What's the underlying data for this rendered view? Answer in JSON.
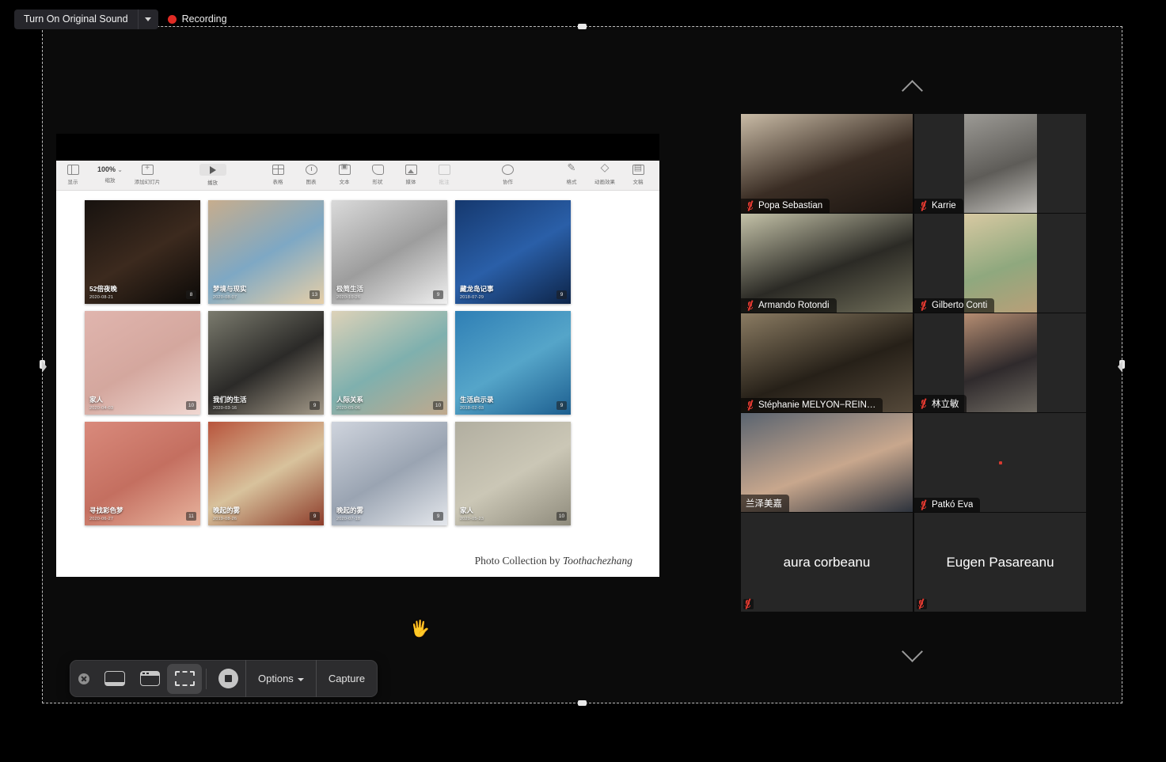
{
  "zoom_toolbar": {
    "original_sound_label": "Turn On Original Sound",
    "dropdown_icon": "chevron-down-icon",
    "recording_label": "Recording",
    "recording_dot_color": "#e02b24"
  },
  "shared_screen": {
    "app": "keynote",
    "toolbar": {
      "zoom_value": "100%",
      "items": [
        {
          "icon": "sidebar-view-icon",
          "label": "显示"
        },
        {
          "icon": "zoom-level-icon",
          "label": "缩放"
        },
        {
          "icon": "add-slide-icon",
          "label": "添加幻灯片"
        },
        {
          "icon": "play-icon",
          "label": "播放"
        },
        {
          "icon": "table-icon",
          "label": "表格"
        },
        {
          "icon": "chart-icon",
          "label": "图表"
        },
        {
          "icon": "text-icon",
          "label": "文本"
        },
        {
          "icon": "shape-icon",
          "label": "形状"
        },
        {
          "icon": "media-icon",
          "label": "媒体"
        },
        {
          "icon": "comment-icon",
          "label": "批注"
        },
        {
          "icon": "collaborate-icon",
          "label": "协作"
        },
        {
          "icon": "format-icon",
          "label": "格式"
        },
        {
          "icon": "animate-icon",
          "label": "动画效果"
        },
        {
          "icon": "document-icon",
          "label": "文稿"
        }
      ]
    },
    "slide": {
      "credit_prefix": "Photo Collection by ",
      "credit_author": "Toothachezhang",
      "photos": [
        {
          "title": "52倍夜晚",
          "date": "2020-08-21",
          "count": "8",
          "palette": [
            "#17120f",
            "#3c2a1e",
            "#0b0907"
          ]
        },
        {
          "title": "梦境与现实",
          "date": "2020-08-07",
          "count": "13",
          "palette": [
            "#c7ad8d",
            "#7ea8c4",
            "#e6cfa8"
          ]
        },
        {
          "title": "极简生活",
          "date": "2020-10-26",
          "count": "9",
          "palette": [
            "#dadada",
            "#9d9d9d",
            "#efefef"
          ]
        },
        {
          "title": "藏龙岛记事",
          "date": "2018-07-29",
          "count": "9",
          "palette": [
            "#15386e",
            "#2a5fa8",
            "#0d2448"
          ]
        },
        {
          "title": "家人",
          "date": "2020-04-03",
          "count": "10",
          "palette": [
            "#e0b5ae",
            "#d4a79e",
            "#f0d8d2"
          ]
        },
        {
          "title": "我们的生活",
          "date": "2020-03-16",
          "count": "9",
          "palette": [
            "#7b7b6e",
            "#2b2a28",
            "#a59b8a"
          ]
        },
        {
          "title": "人际关系",
          "date": "2020-05-06",
          "count": "10",
          "palette": [
            "#ddd2b8",
            "#7fb0ae",
            "#c0a98d"
          ]
        },
        {
          "title": "生活启示录",
          "date": "2018-02-03",
          "count": "9",
          "palette": [
            "#2f7fb5",
            "#55a5c9",
            "#1d5f90"
          ]
        },
        {
          "title": "寻找彩色梦",
          "date": "2020-06-27",
          "count": "11",
          "palette": [
            "#d98a7c",
            "#c46f60",
            "#e8b49e"
          ]
        },
        {
          "title": "晚起的雾",
          "date": "2019-08-26",
          "count": "9",
          "palette": [
            "#b8543c",
            "#d8c29c",
            "#8d3c2a"
          ]
        },
        {
          "title": "晚起的雾",
          "date": "2020-07-18",
          "count": "9",
          "palette": [
            "#cfd4dd",
            "#9aa4b2",
            "#e4e7ec"
          ]
        },
        {
          "title": "家人",
          "date": "2020-05-23",
          "count": "10",
          "palette": [
            "#b1aea0",
            "#cbc7b6",
            "#8f8b7c"
          ]
        }
      ]
    }
  },
  "participants": {
    "scroll_up_icon": "chevron-up-icon",
    "scroll_down_icon": "chevron-down-icon",
    "tiles": [
      {
        "name": "Popa Sebastian",
        "muted": true,
        "video": true,
        "fit": "cover",
        "palette": [
          "#c9bba6",
          "#3a2d24",
          "#1a1410"
        ]
      },
      {
        "name": "Karrie",
        "muted": true,
        "video": true,
        "fit": "contain",
        "palette": [
          "#9c9a95",
          "#5e5c58",
          "#c2c0bb"
        ]
      },
      {
        "name": "Armando Rotondi",
        "muted": true,
        "video": true,
        "fit": "cover",
        "palette": [
          "#c4c2a8",
          "#2b2a25",
          "#6e6c58"
        ]
      },
      {
        "name": "Gilberto Conti",
        "muted": true,
        "video": true,
        "fit": "contain",
        "palette": [
          "#d8c9a2",
          "#8fa87e",
          "#b99f78"
        ]
      },
      {
        "name": "Stéphanie MELYON−REIN…",
        "muted": true,
        "video": true,
        "fit": "cover",
        "palette": [
          "#8a7b62",
          "#262018",
          "#55493a"
        ]
      },
      {
        "name": "林立敏",
        "muted": true,
        "video": true,
        "fit": "contain",
        "palette": [
          "#b58d72",
          "#2f2a2c",
          "#6f6a62"
        ]
      },
      {
        "name": "兰泽美嘉",
        "muted": false,
        "video": true,
        "fit": "cover",
        "palette": [
          "#5a6470",
          "#c8a78d",
          "#2c323c"
        ],
        "active": true
      },
      {
        "name": "Patkó Éva",
        "muted": true,
        "video": false,
        "fit": "none",
        "palette": [
          "#262626"
        ],
        "red_dot": true
      },
      {
        "name": "aura corbeanu",
        "muted": true,
        "video": false,
        "fit": "none",
        "palette": [
          "#262626"
        ],
        "name_centered": true
      },
      {
        "name": "Eugen Pasareanu",
        "muted": true,
        "video": false,
        "fit": "none",
        "palette": [
          "#262626"
        ],
        "name_centered": true
      }
    ],
    "active_border_color": "#e8f08a"
  },
  "capture_toolbar": {
    "close_icon": "close-icon",
    "buttons": [
      {
        "icon": "capture-entire-screen-icon",
        "selected": false
      },
      {
        "icon": "capture-window-icon",
        "selected": false
      },
      {
        "icon": "capture-selection-icon",
        "selected": true
      },
      {
        "icon": "record-icon",
        "selected": false
      }
    ],
    "options_label": "Options",
    "options_caret": "chevron-down-icon",
    "capture_label": "Capture"
  },
  "cursor": {
    "icon": "open-hand-cursor"
  }
}
